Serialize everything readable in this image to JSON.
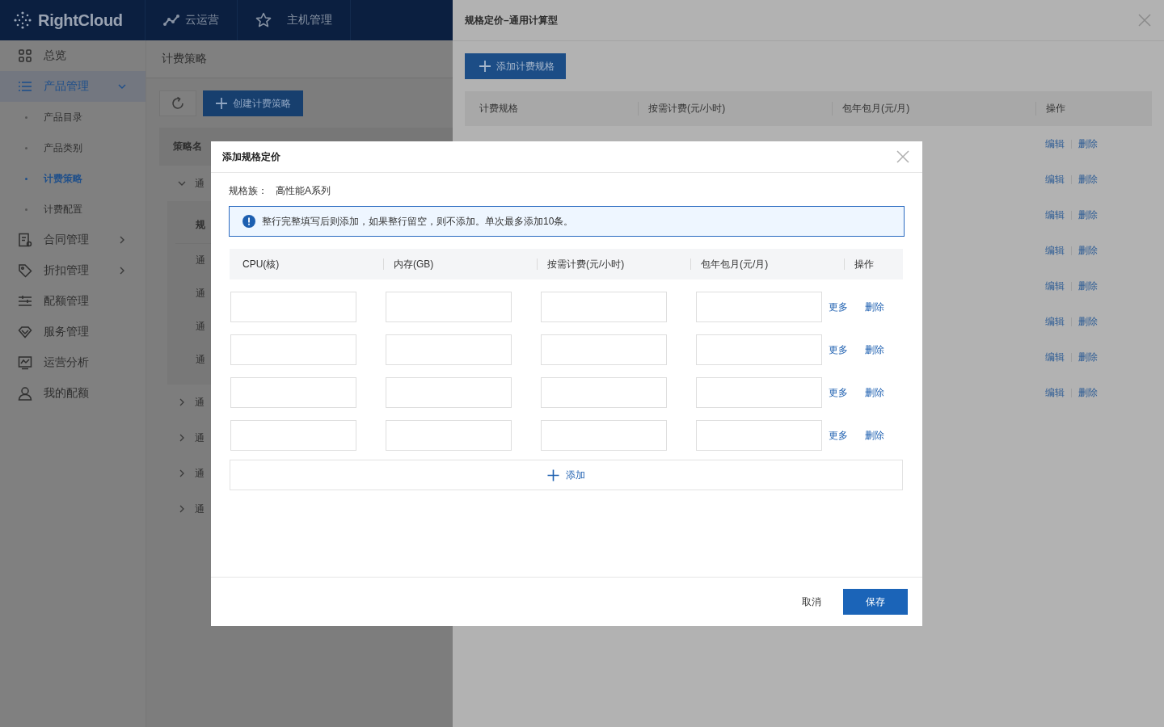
{
  "top_nav": {
    "brand": "RightCloud",
    "items": [
      {
        "label": "云运营"
      },
      {
        "label": "主机管理"
      }
    ]
  },
  "sidebar": {
    "items": [
      {
        "label": "总览",
        "selected": false
      },
      {
        "label": "产品管理",
        "selected": true,
        "expanded": true,
        "children": [
          {
            "label": "产品目录",
            "selected": false
          },
          {
            "label": "产品类别",
            "selected": false
          },
          {
            "label": "计费策略",
            "selected": true
          },
          {
            "label": "计费配置",
            "selected": false
          }
        ]
      },
      {
        "label": "合同管理",
        "selected": false,
        "expanded": false
      },
      {
        "label": "折扣管理",
        "selected": false,
        "expanded": false
      },
      {
        "label": "配额管理",
        "selected": false
      },
      {
        "label": "服务管理",
        "selected": false
      },
      {
        "label": "运营分析",
        "selected": false
      },
      {
        "label": "我的配额",
        "selected": false
      }
    ]
  },
  "page": {
    "title": "计费策略",
    "create_button": "创建计费策略",
    "table": {
      "column_1": "策略名",
      "groups": [
        {
          "name": "通",
          "expanded": true,
          "inner_header": "规",
          "inner_rows": [
            "通",
            "通",
            "通",
            "通"
          ]
        },
        {
          "name": "通",
          "expanded": false
        },
        {
          "name": "通",
          "expanded": false
        },
        {
          "name": "通",
          "expanded": false
        },
        {
          "name": "通",
          "expanded": false
        }
      ]
    }
  },
  "drawer": {
    "title": "规格定价–通用计算型",
    "add_button": "添加计费规格",
    "columns": [
      "计费规格",
      "按需计费(元/小时)",
      "包年包月(元/月)",
      "操作"
    ],
    "rows": [
      {
        "actions": [
          "编辑",
          "删除"
        ]
      },
      {
        "actions": [
          "编辑",
          "删除"
        ]
      },
      {
        "actions": [
          "编辑",
          "删除"
        ]
      },
      {
        "actions": [
          "编辑",
          "删除"
        ]
      },
      {
        "actions": [
          "编辑",
          "删除"
        ]
      },
      {
        "actions": [
          "编辑",
          "删除"
        ]
      },
      {
        "actions": [
          "编辑",
          "删除"
        ]
      },
      {
        "actions": [
          "编辑",
          "删除"
        ]
      }
    ]
  },
  "dialog": {
    "title": "添加规格定价",
    "family_label": "规格族：",
    "family_value": "高性能A系列",
    "alert": "整行完整填写后则添加，如果整行留空，则不添加。单次最多添加10条。",
    "columns": [
      "CPU(核)",
      "内存(GB)",
      "按需计费(元/小时)",
      "包年包月(元/月)",
      "操作"
    ],
    "rows": [
      {
        "actions": [
          "更多",
          "删除"
        ]
      },
      {
        "actions": [
          "更多",
          "删除"
        ]
      },
      {
        "actions": [
          "更多",
          "删除"
        ]
      },
      {
        "actions": [
          "更多",
          "删除"
        ]
      }
    ],
    "add_row": "添加",
    "cancel": "取消",
    "save": "保存"
  }
}
